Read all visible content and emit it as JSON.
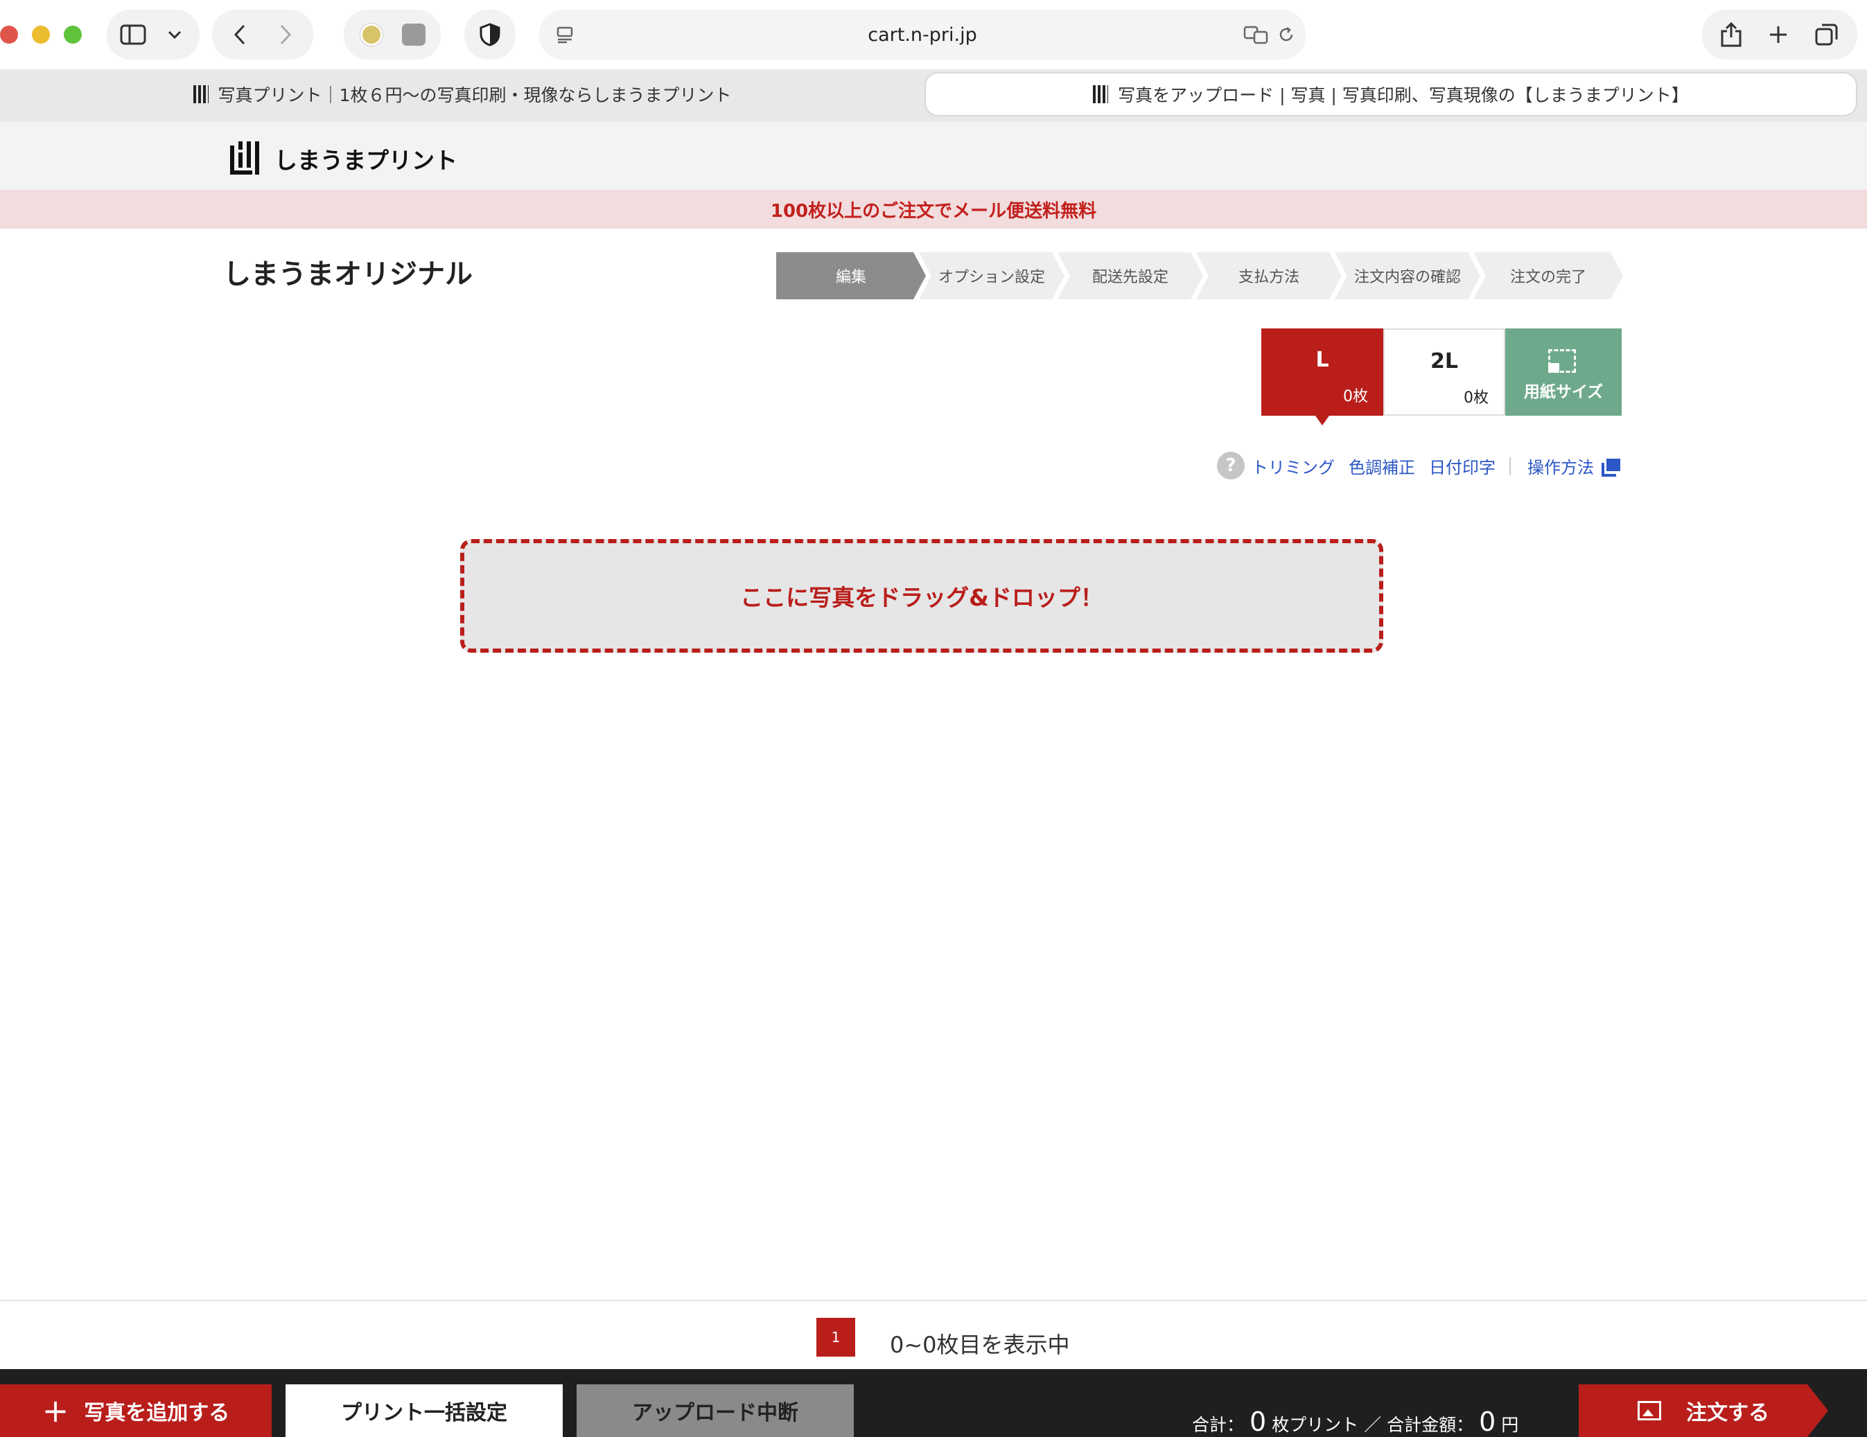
{
  "browser": {
    "url": "cart.n-pri.jp",
    "tabs": [
      {
        "title": "写真プリント｜1枚６円〜の写真印刷・現像ならしまうまプリント"
      },
      {
        "title": "写真をアップロード | 写真 | 写真印刷、写真現像の【しまうまプリント】"
      }
    ]
  },
  "header": {
    "logo_text": "しまうまプリント",
    "promo": "100枚以上のご注文でメール便送料無料"
  },
  "page": {
    "title": "しまうまオリジナル",
    "steps": [
      "編集",
      "オプション設定",
      "配送先設定",
      "支払方法",
      "注文内容の確認",
      "注文の完了"
    ],
    "active_step": 0
  },
  "sizes": {
    "l": {
      "name": "L",
      "count": "0枚"
    },
    "twol": {
      "name": "2L",
      "count": "0枚"
    },
    "paper_size_label": "用紙サイズ"
  },
  "tools": {
    "help": "?",
    "trimming": "トリミング",
    "color": "色調補正",
    "date": "日付印字",
    "howto": "操作方法"
  },
  "dropzone": {
    "text": "ここに写真をドラッグ&ドロップ！"
  },
  "pagination": {
    "current_page": "1",
    "showing": "0~0枚目を表示中"
  },
  "bottom": {
    "add_photo": "写真を追加する",
    "bulk_settings": "プリント一括設定",
    "abort_upload": "アップロード中断",
    "total_label": "合計：",
    "total_count": "0",
    "total_unit": "枚プリント ／ 合計金額：",
    "total_price": "0",
    "currency": "円",
    "order": "注文する"
  },
  "colors": {
    "brand_red": "#b91e1b",
    "promo_bg": "#f3dcdd",
    "paper_green": "#6ea98b",
    "link_blue": "#2a56c6"
  }
}
